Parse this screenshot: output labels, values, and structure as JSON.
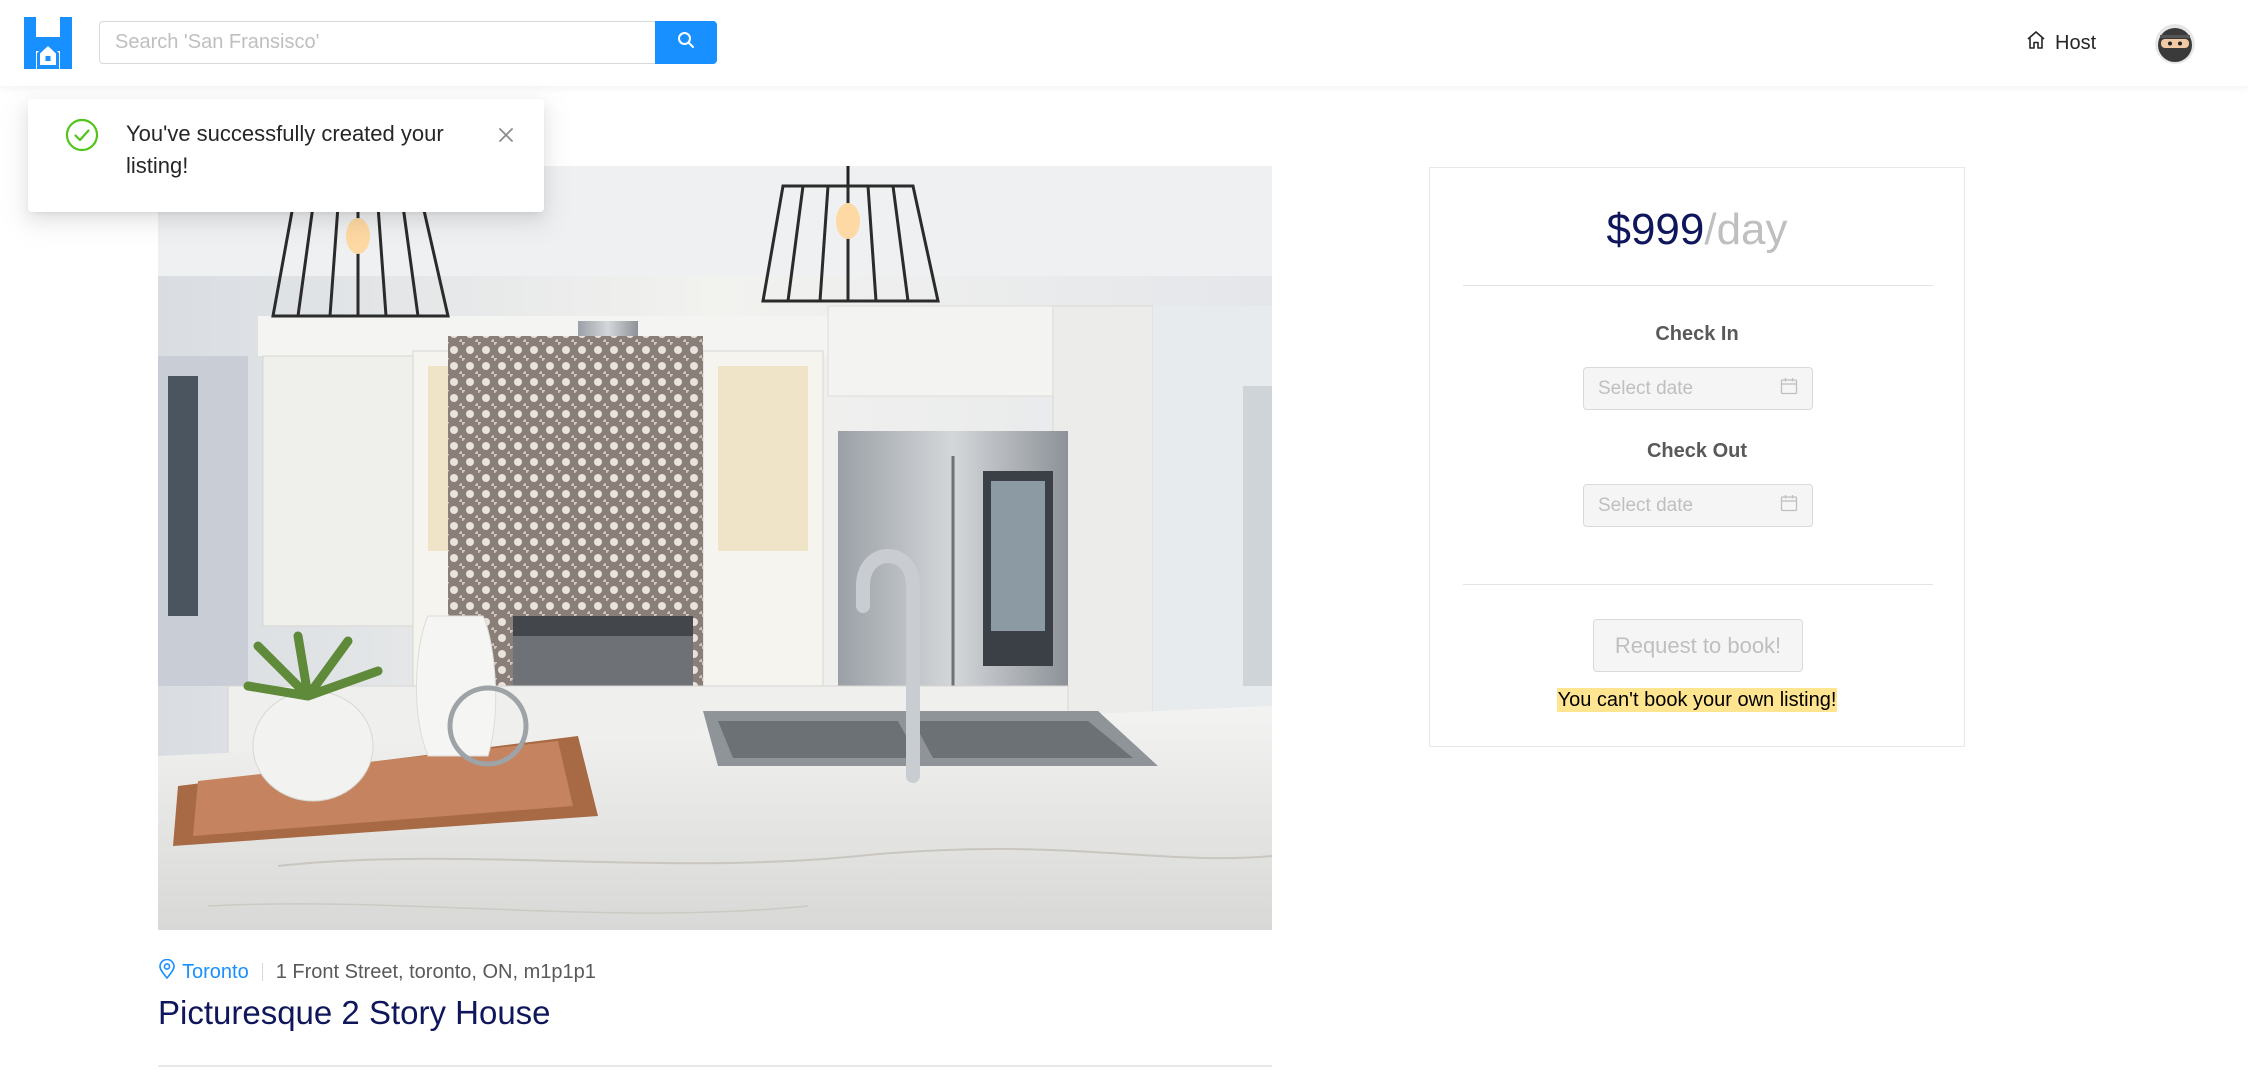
{
  "header": {
    "logo_icon": "house-logo-icon",
    "search": {
      "placeholder": "Search 'San Fransisco'",
      "value": ""
    },
    "search_icon": "search-icon",
    "host_label": "Host",
    "host_icon": "home-icon",
    "avatar_icon": "ninja-avatar"
  },
  "notification": {
    "icon": "check-circle-icon",
    "message": "You've successfully created your listing!",
    "close_icon": "close-icon"
  },
  "listing": {
    "image": "kitchen-photo",
    "city": "Toronto",
    "address": "1 Front Street, toronto, ON, m1p1p1",
    "title": "Picturesque 2 Story House"
  },
  "booking": {
    "price": "$999",
    "price_unit": "/day",
    "check_in_label": "Check In",
    "check_in_placeholder": "Select date",
    "check_out_label": "Check Out",
    "check_out_placeholder": "Select date",
    "book_button_label": "Request to book!",
    "warning": "You can't book your own listing!"
  },
  "colors": {
    "accent": "#1890ff",
    "title": "#10165b",
    "success": "#52c41a",
    "warning_bg": "#ffe58f"
  }
}
